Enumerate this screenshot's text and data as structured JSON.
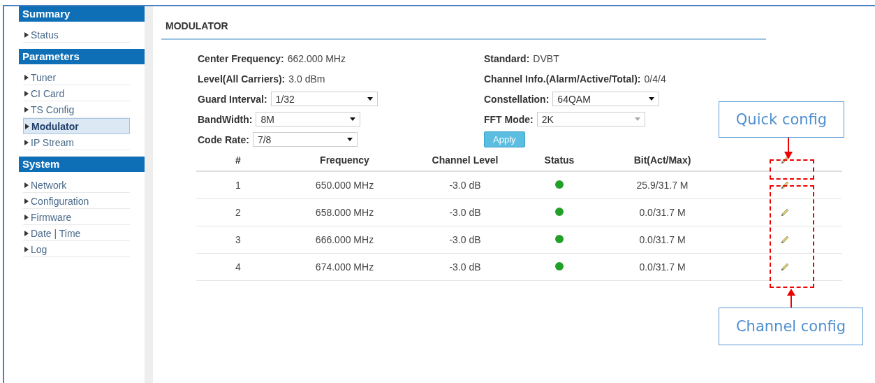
{
  "sidebar": [
    {
      "title": "Summary",
      "items": [
        {
          "label": "Status",
          "selected": false
        }
      ]
    },
    {
      "title": "Parameters",
      "items": [
        {
          "label": "Tuner",
          "selected": false
        },
        {
          "label": "CI Card",
          "selected": false
        },
        {
          "label": "TS Config",
          "selected": false
        },
        {
          "label": "Modulator",
          "selected": true
        },
        {
          "label": "IP Stream",
          "selected": false
        }
      ]
    },
    {
      "title": "System",
      "items": [
        {
          "label": "Network",
          "selected": false
        },
        {
          "label": "Configuration",
          "selected": false
        },
        {
          "label": "Firmware",
          "selected": false
        },
        {
          "label": "Date | Time",
          "selected": false
        },
        {
          "label": "Log",
          "selected": false
        }
      ]
    }
  ],
  "section_title": "MODULATOR",
  "left_fields": [
    {
      "kind": "text",
      "label": "Center Frequency:",
      "value": "662.000 MHz"
    },
    {
      "kind": "text",
      "label": "Level(All Carriers):",
      "value": "3.0 dBm"
    },
    {
      "kind": "select",
      "label": "Guard Interval:",
      "value": "1/32",
      "disabled": false
    },
    {
      "kind": "select",
      "label": "BandWidth:",
      "value": "8M",
      "disabled": false
    },
    {
      "kind": "select",
      "label": "Code Rate:",
      "value": "7/8",
      "disabled": false
    }
  ],
  "right_fields": [
    {
      "kind": "text",
      "label": "Standard:",
      "value": "DVBT"
    },
    {
      "kind": "text",
      "label": "Channel Info.(Alarm/Active/Total):",
      "value": "0/4/4"
    },
    {
      "kind": "select",
      "label": "Constellation:",
      "value": "64QAM",
      "disabled": false
    },
    {
      "kind": "select",
      "label": "FFT Mode:",
      "value": "2K",
      "disabled": true
    }
  ],
  "apply_button": "Apply",
  "table": {
    "columns": [
      "#",
      "Frequency",
      "Channel Level",
      "Status",
      "Bit(Act/Max)"
    ],
    "rows": [
      {
        "index": "1",
        "frequency": "650.000 MHz",
        "level": "-3.0 dB",
        "color": "#22a02a",
        "bit": "25.9/31.7 M"
      },
      {
        "index": "2",
        "frequency": "658.000 MHz",
        "level": "-3.0 dB",
        "color": "#22a02a",
        "bit": "0.0/31.7 M"
      },
      {
        "index": "3",
        "frequency": "666.000 MHz",
        "level": "-3.0 dB",
        "color": "#22a02a",
        "bit": "0.0/31.7 M"
      },
      {
        "index": "4",
        "frequency": "674.000 MHz",
        "level": "-3.0 dB",
        "color": "#22a02a",
        "bit": "0.0/31.7 M"
      }
    ]
  },
  "callouts": [
    {
      "kind": "quick",
      "text": "Quick config"
    },
    {
      "kind": "channel",
      "text": "Channel config"
    }
  ]
}
